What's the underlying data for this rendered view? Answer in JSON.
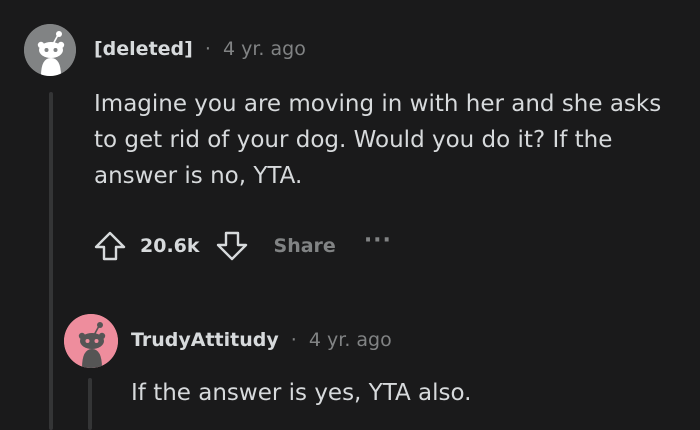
{
  "comments": [
    {
      "author": "[deleted]",
      "time": "4 yr. ago",
      "body": "Imagine you are moving in with her and she asks to get rid of your dog. Would you do it? If the answer is no, YTA.",
      "score": "20.6k",
      "share_label": "Share",
      "more_label": "···",
      "avatar_color": "#818384"
    },
    {
      "author": "TrudyAttitudy",
      "time": "4 yr. ago",
      "body": "If the answer is yes, YTA also.",
      "avatar_color": "#ee8d9d"
    }
  ],
  "separator": "·",
  "colors": {
    "background": "#1a1a1b",
    "text": "#d7dadc",
    "muted": "#818384",
    "thread_line": "#343536"
  },
  "icons": {
    "upvote": "arrow-up-outline-icon",
    "downvote": "arrow-down-outline-icon",
    "more": "overflow-dots-icon",
    "avatar": "snoo-avatar-icon"
  }
}
